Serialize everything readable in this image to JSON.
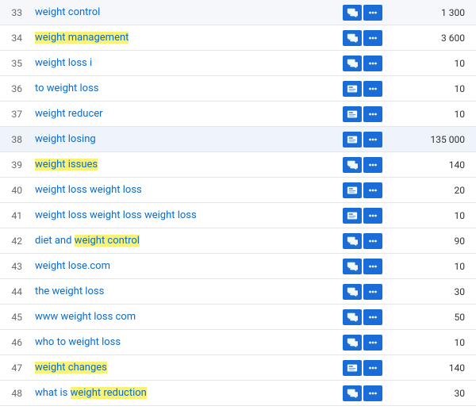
{
  "rows": [
    {
      "num": "33",
      "keyword": "weight control",
      "highlight": [],
      "icon": "chat",
      "volume": "1 300",
      "selected": false
    },
    {
      "num": "34",
      "keyword": "weight management",
      "highlight": [
        "weight management"
      ],
      "icon": "chat",
      "volume": "3 600",
      "selected": false
    },
    {
      "num": "35",
      "keyword": "weight loss i",
      "highlight": [],
      "icon": "chat",
      "volume": "10",
      "selected": false
    },
    {
      "num": "36",
      "keyword": "to weight loss",
      "highlight": [],
      "icon": "card",
      "volume": "10",
      "selected": false
    },
    {
      "num": "37",
      "keyword": "weight reducer",
      "highlight": [],
      "icon": "card",
      "volume": "10",
      "selected": false
    },
    {
      "num": "38",
      "keyword": "weight losing",
      "highlight": [],
      "icon": "card",
      "volume": "135 000",
      "selected": true
    },
    {
      "num": "39",
      "keyword": "weight issues",
      "highlight": [
        "weight issues"
      ],
      "icon": "chat",
      "volume": "140",
      "selected": false
    },
    {
      "num": "40",
      "keyword": "weight loss weight loss",
      "highlight": [],
      "icon": "card",
      "volume": "20",
      "selected": false
    },
    {
      "num": "41",
      "keyword": "weight loss weight loss weight loss",
      "highlight": [],
      "icon": "card",
      "volume": "10",
      "selected": false
    },
    {
      "num": "42",
      "keyword": "diet and weight control",
      "highlight": [
        "weight control"
      ],
      "icon": "chat",
      "volume": "90",
      "selected": false
    },
    {
      "num": "43",
      "keyword": "weight lose.com",
      "highlight": [],
      "icon": "chat",
      "volume": "10",
      "selected": false
    },
    {
      "num": "44",
      "keyword": "the weight loss",
      "highlight": [],
      "icon": "chat",
      "volume": "30",
      "selected": false
    },
    {
      "num": "45",
      "keyword": "www weight loss com",
      "highlight": [],
      "icon": "chat",
      "volume": "50",
      "selected": false
    },
    {
      "num": "46",
      "keyword": "who to weight loss",
      "highlight": [],
      "icon": "chat",
      "volume": "10",
      "selected": false
    },
    {
      "num": "47",
      "keyword": "weight changes",
      "highlight": [
        "weight changes"
      ],
      "icon": "card",
      "volume": "140",
      "selected": false
    },
    {
      "num": "48",
      "keyword": "what is weight reduction",
      "highlight": [
        "weight reduction"
      ],
      "icon": "chat",
      "volume": "30",
      "selected": false
    }
  ],
  "icons": {
    "chat": "chat-icon",
    "card": "card-icon",
    "more": "more-icon"
  }
}
